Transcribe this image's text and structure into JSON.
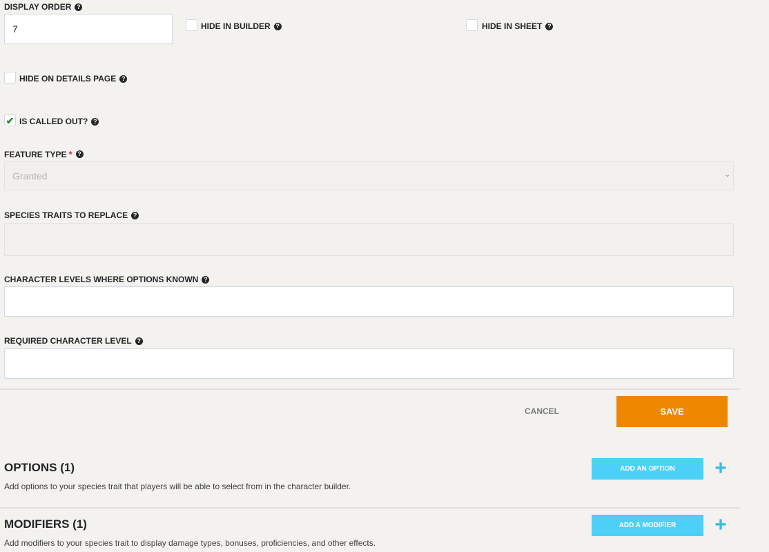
{
  "display_order": {
    "label": "DISPLAY ORDER",
    "value": "7"
  },
  "hide_in_builder": {
    "label": "HIDE IN BUILDER",
    "checked": false
  },
  "hide_in_sheet": {
    "label": "HIDE IN SHEET",
    "checked": false
  },
  "hide_on_details": {
    "label": "HIDE ON DETAILS PAGE",
    "checked": false
  },
  "is_called_out": {
    "label": "IS CALLED OUT?",
    "checked": true
  },
  "feature_type": {
    "label": "FEATURE TYPE",
    "required_mark": "*",
    "value": "Granted"
  },
  "species_traits": {
    "label": "SPECIES TRAITS TO REPLACE",
    "value": ""
  },
  "char_levels_options": {
    "label": "CHARACTER LEVELS WHERE OPTIONS KNOWN",
    "value": ""
  },
  "required_level": {
    "label": "REQUIRED CHARACTER LEVEL",
    "value": ""
  },
  "actions": {
    "cancel": "CANCEL",
    "save": "SAVE"
  },
  "options_section": {
    "title": "OPTIONS (1)",
    "description": "Add options to your species trait that players will be able to select from in the character builder.",
    "button": "ADD AN OPTION"
  },
  "modifiers_section": {
    "title": "MODIFIERS (1)",
    "description": "Add modifiers to your species trait to display damage types, bonuses, proficiencies, and other effects.",
    "button": "ADD A MODIFIER"
  },
  "icons": {
    "help": "question-circle-icon",
    "check": "checkmark-icon",
    "plus": "plus-icon",
    "dropdown": "chevron-down-icon"
  },
  "colors": {
    "save": "#ee8600",
    "add": "#4dd0f7",
    "plus": "#34bbe9",
    "check": "#1c8d2a",
    "required": "#c53131"
  }
}
